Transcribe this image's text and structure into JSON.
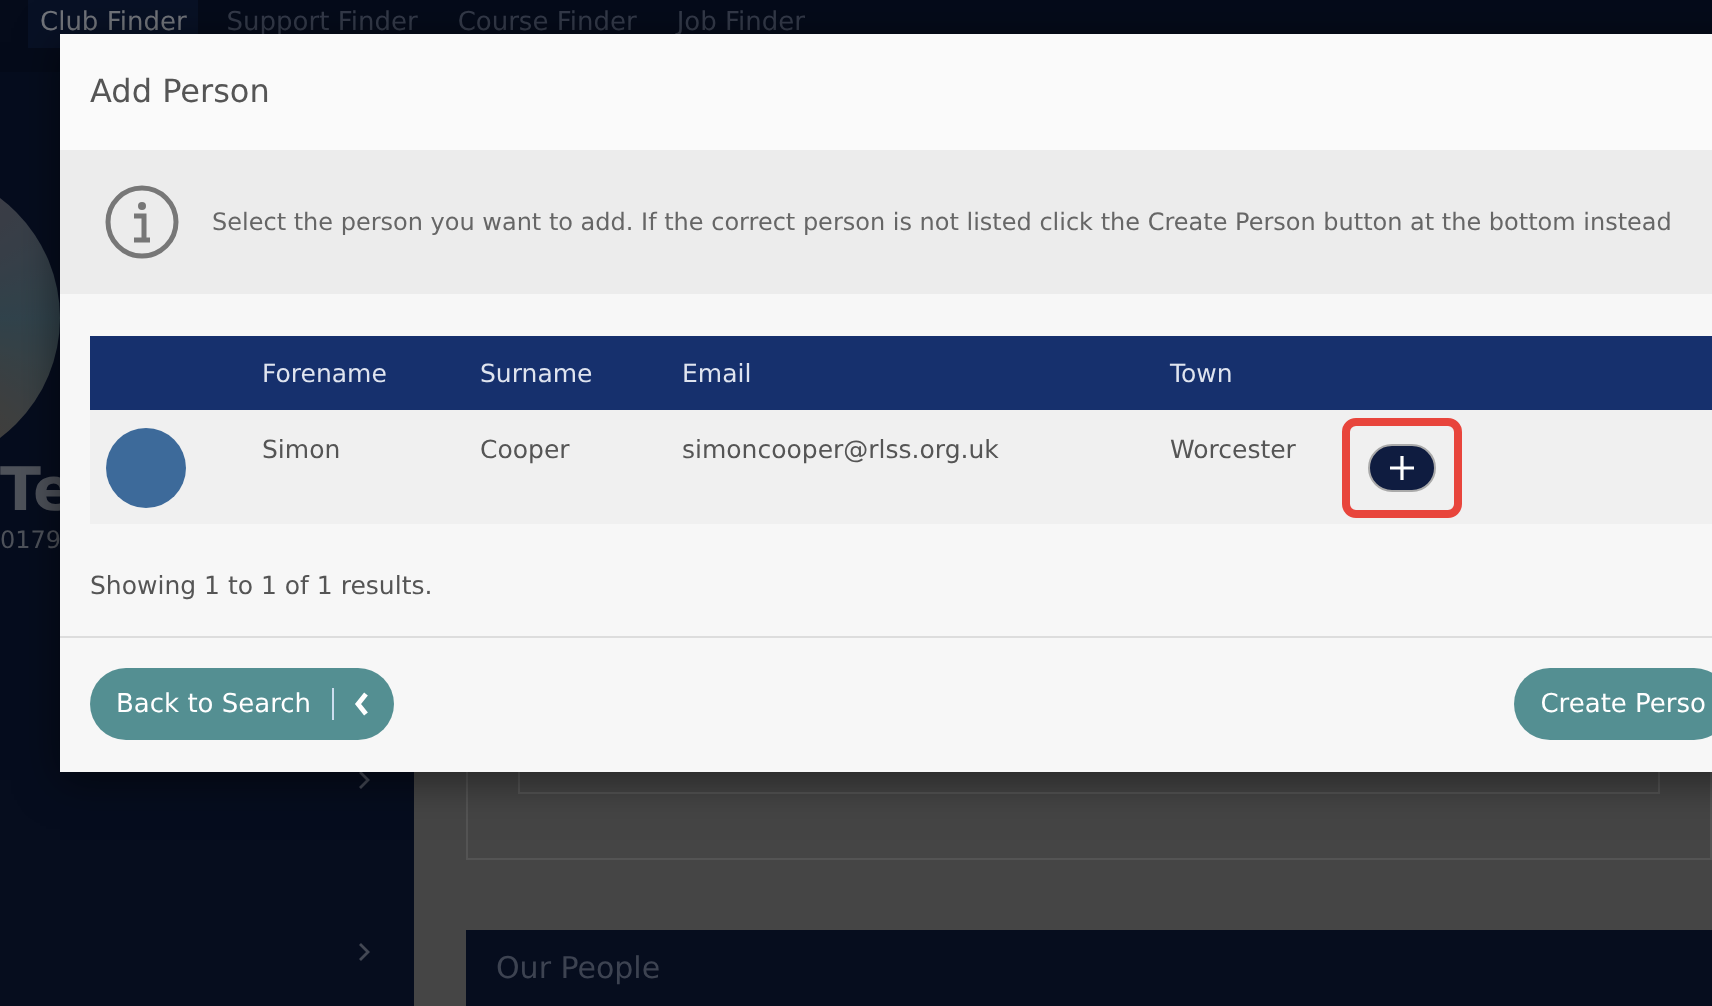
{
  "nav": [
    {
      "label": "Club Finder",
      "selected": true
    },
    {
      "label": "Support Finder",
      "selected": false
    },
    {
      "label": "Course Finder",
      "selected": false
    },
    {
      "label": "Job Finder",
      "selected": false
    }
  ],
  "sidebar": {
    "name": "Te",
    "number": "0179"
  },
  "section": {
    "title": "Our People"
  },
  "dialog": {
    "title": "Add Person",
    "info": "Select the person you want to add. If the correct person is not listed click the Create Person button at the bottom instead",
    "columns": [
      "Forename",
      "Surname",
      "Email",
      "Town"
    ],
    "rows": [
      {
        "forename": "Simon",
        "surname": "Cooper",
        "email": "simoncooper@rlss.org.uk",
        "town": "Worcester",
        "highlighted": true
      }
    ],
    "summary": "Showing 1 to 1 of 1 results.",
    "back_button": "Back to Search",
    "create_button": "Create Perso"
  }
}
